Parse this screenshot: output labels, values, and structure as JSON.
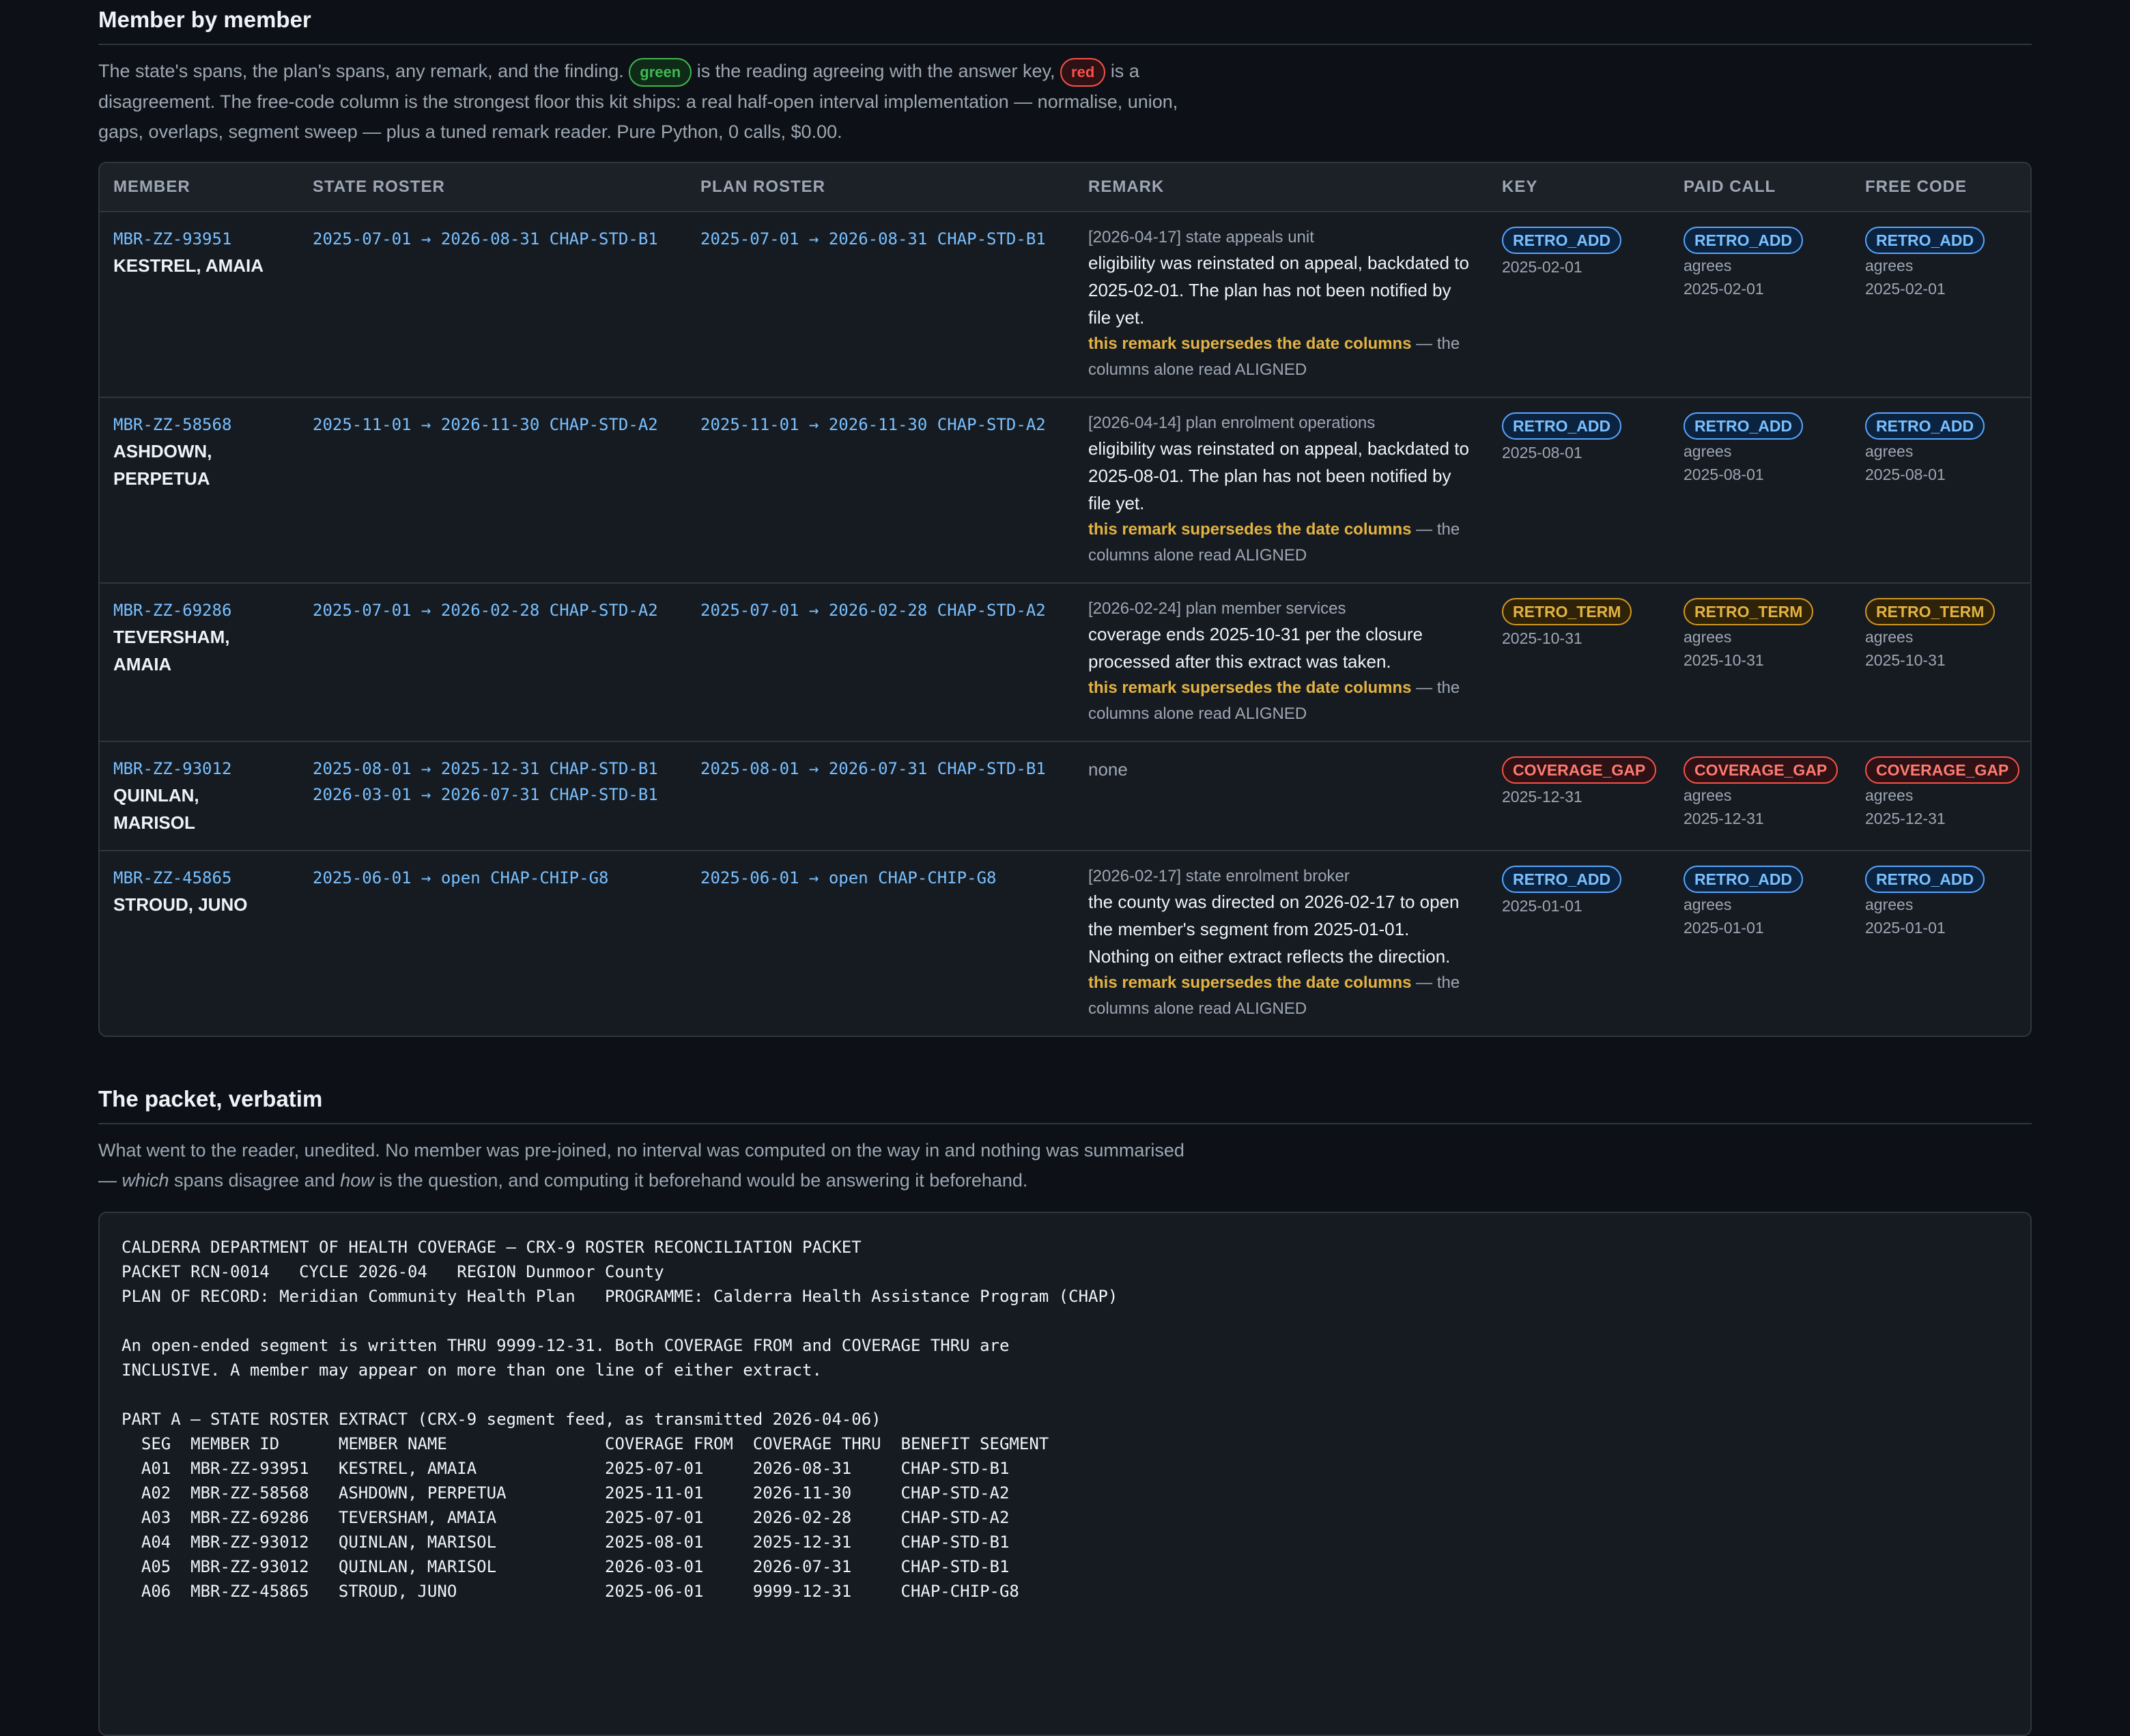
{
  "section1": {
    "title": "Member by member",
    "intro_before_green": "The state's spans, the plan's spans, any remark, and the finding.",
    "green_pill": "green",
    "intro_mid": "is the reading agreeing with the answer key,",
    "red_pill": "red",
    "intro_after": "is a disagreement. The free-code column is the strongest floor this kit ships: a real half-open interval implementation — normalise, union, gaps, overlaps, segment sweep — plus a tuned remark reader. Pure Python, 0 calls, $0.00."
  },
  "columns": [
    "MEMBER",
    "STATE ROSTER",
    "PLAN ROSTER",
    "REMARK",
    "KEY",
    "PAID CALL",
    "FREE CODE"
  ],
  "rows": [
    {
      "id": "MBR-ZZ-93951",
      "name": "KESTREL, AMAIA",
      "state": "2025-07-01 → 2026-08-31 CHAP-STD-B1",
      "state2": "",
      "plan": "2025-07-01 → 2026-08-31 CHAP-STD-B1",
      "remark_src": "[2026-04-17] state appeals unit",
      "remark_text": "eligibility was reinstated on appeal, backdated to 2025-02-01. The plan has not been notified by file yet.",
      "supersede": "this remark supersedes the date columns",
      "supersede_tail": " — the columns alone read ALIGNED",
      "key": "RETRO_ADD",
      "key_date": "2025-02-01",
      "paid": "RETRO_ADD",
      "paid_note": "agrees",
      "paid_date": "2025-02-01",
      "free": "RETRO_ADD",
      "free_note": "agrees",
      "free_date": "2025-02-01"
    },
    {
      "id": "MBR-ZZ-58568",
      "name": "ASHDOWN, PERPETUA",
      "state": "2025-11-01 → 2026-11-30 CHAP-STD-A2",
      "state2": "",
      "plan": "2025-11-01 → 2026-11-30 CHAP-STD-A2",
      "remark_src": "[2026-04-14] plan enrolment operations",
      "remark_text": "eligibility was reinstated on appeal, backdated to 2025-08-01. The plan has not been notified by file yet.",
      "supersede": "this remark supersedes the date columns",
      "supersede_tail": " — the columns alone read ALIGNED",
      "key": "RETRO_ADD",
      "key_date": "2025-08-01",
      "paid": "RETRO_ADD",
      "paid_note": "agrees",
      "paid_date": "2025-08-01",
      "free": "RETRO_ADD",
      "free_note": "agrees",
      "free_date": "2025-08-01"
    },
    {
      "id": "MBR-ZZ-69286",
      "name": "TEVERSHAM, AMAIA",
      "state": "2025-07-01 → 2026-02-28 CHAP-STD-A2",
      "state2": "",
      "plan": "2025-07-01 → 2026-02-28 CHAP-STD-A2",
      "remark_src": "[2026-02-24] plan member services",
      "remark_text": "coverage ends 2025-10-31 per the closure processed after this extract was taken.",
      "supersede": "this remark supersedes the date columns",
      "supersede_tail": " — the columns alone read ALIGNED",
      "key": "RETRO_TERM",
      "key_date": "2025-10-31",
      "paid": "RETRO_TERM",
      "paid_note": "agrees",
      "paid_date": "2025-10-31",
      "free": "RETRO_TERM",
      "free_note": "agrees",
      "free_date": "2025-10-31"
    },
    {
      "id": "MBR-ZZ-93012",
      "name": "QUINLAN, MARISOL",
      "state": "2025-08-01 → 2025-12-31 CHAP-STD-B1",
      "state2": "2026-03-01 → 2026-07-31 CHAP-STD-B1",
      "plan": "2025-08-01 → 2026-07-31 CHAP-STD-B1",
      "remark_src": "",
      "remark_text": "",
      "remark_none": "none",
      "supersede": "",
      "supersede_tail": "",
      "key": "COVERAGE_GAP",
      "key_date": "2025-12-31",
      "paid": "COVERAGE_GAP",
      "paid_note": "agrees",
      "paid_date": "2025-12-31",
      "free": "COVERAGE_GAP",
      "free_note": "agrees",
      "free_date": "2025-12-31"
    },
    {
      "id": "MBR-ZZ-45865",
      "name": "STROUD, JUNO",
      "state": "2025-06-01 → open CHAP-CHIP-G8",
      "state2": "",
      "plan": "2025-06-01 → open CHAP-CHIP-G8",
      "remark_src": "[2026-02-17] state enrolment broker",
      "remark_text": "the county was directed on 2026-02-17 to open the member's segment from 2025-01-01. Nothing on either extract reflects the direction.",
      "supersede": "this remark supersedes the date columns",
      "supersede_tail": " — the columns alone read ALIGNED",
      "key": "RETRO_ADD",
      "key_date": "2025-01-01",
      "paid": "RETRO_ADD",
      "paid_note": "agrees",
      "paid_date": "2025-01-01",
      "free": "RETRO_ADD",
      "free_note": "agrees",
      "free_date": "2025-01-01"
    }
  ],
  "badge_colors": {
    "RETRO_ADD": "#58a6ff",
    "RETRO_TERM": "#d29922",
    "COVERAGE_GAP": "#f85149"
  },
  "section2": {
    "title": "The packet, verbatim",
    "intro_a": "What went to the reader, unedited. No member was pre-joined, no interval was computed on the way in and nothing was summarised — ",
    "intro_which": "which",
    "intro_b": " spans disagree and ",
    "intro_how": "how",
    "intro_c": " is the question, and computing it beforehand would be answering it beforehand.",
    "packet": "CALDERRA DEPARTMENT OF HEALTH COVERAGE — CRX-9 ROSTER RECONCILIATION PACKET\nPACKET RCN-0014   CYCLE 2026-04   REGION Dunmoor County\nPLAN OF RECORD: Meridian Community Health Plan   PROGRAMME: Calderra Health Assistance Program (CHAP)\n\nAn open-ended segment is written THRU 9999-12-31. Both COVERAGE FROM and COVERAGE THRU are\nINCLUSIVE. A member may appear on more than one line of either extract.\n\nPART A — STATE ROSTER EXTRACT (CRX-9 segment feed, as transmitted 2026-04-06)\n  SEG  MEMBER ID      MEMBER NAME                COVERAGE FROM  COVERAGE THRU  BENEFIT SEGMENT\n  A01  MBR-ZZ-93951   KESTREL, AMAIA             2025-07-01     2026-08-31     CHAP-STD-B1\n  A02  MBR-ZZ-58568   ASHDOWN, PERPETUA          2025-11-01     2026-11-30     CHAP-STD-A2\n  A03  MBR-ZZ-69286   TEVERSHAM, AMAIA           2025-07-01     2026-02-28     CHAP-STD-A2\n  A04  MBR-ZZ-93012   QUINLAN, MARISOL           2025-08-01     2025-12-31     CHAP-STD-B1\n  A05  MBR-ZZ-93012   QUINLAN, MARISOL           2026-03-01     2026-07-31     CHAP-STD-B1\n  A06  MBR-ZZ-45865   STROUD, JUNO               2025-06-01     9999-12-31     CHAP-CHIP-G8"
  }
}
